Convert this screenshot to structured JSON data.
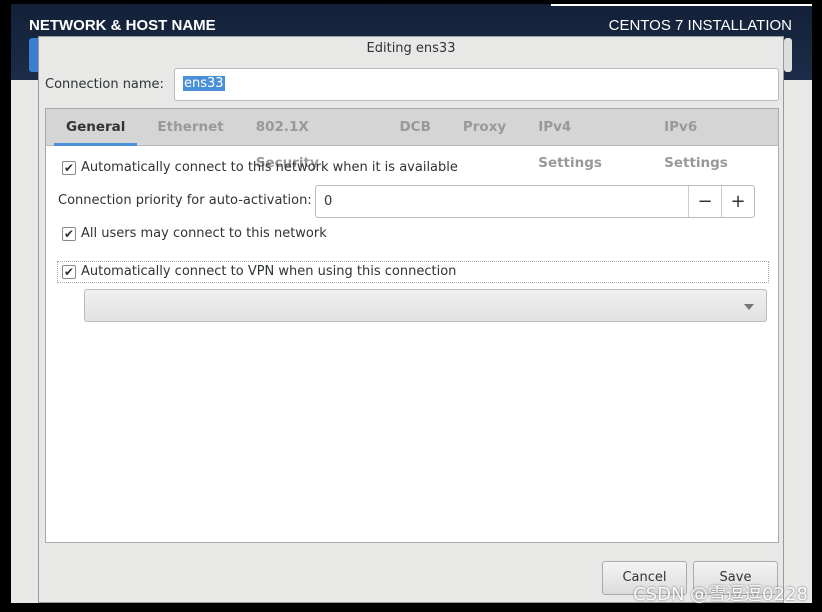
{
  "header": {
    "title": "NETWORK & HOST NAME",
    "product": "CENTOS 7 INSTALLATION"
  },
  "dialog": {
    "title": "Editing ens33",
    "connection_name_label": "Connection name:",
    "connection_name_value": "ens33",
    "tabs": [
      {
        "label": "General",
        "active": true
      },
      {
        "label": "Ethernet"
      },
      {
        "label": "802.1X Security"
      },
      {
        "label": "DCB"
      },
      {
        "label": "Proxy"
      },
      {
        "label": "IPv4 Settings"
      },
      {
        "label": "IPv6 Settings"
      }
    ],
    "general": {
      "auto_connect": {
        "label": "Automatically connect to this network when it is available",
        "checked": true
      },
      "priority_label": "Connection priority for auto-activation:",
      "priority_value": "0",
      "minus": "−",
      "plus": "+",
      "all_users": {
        "label": "All users may connect to this network",
        "checked": true
      },
      "auto_vpn": {
        "label": "Automatically connect to VPN when using this connection",
        "checked": true
      },
      "vpn_selected": ""
    },
    "cancel_label": "Cancel",
    "save_label": "Save"
  },
  "watermark": "CSDN @雪逗逗0228",
  "colors": {
    "accent": "#4a90d9",
    "header_bg": "#1c2c48"
  }
}
